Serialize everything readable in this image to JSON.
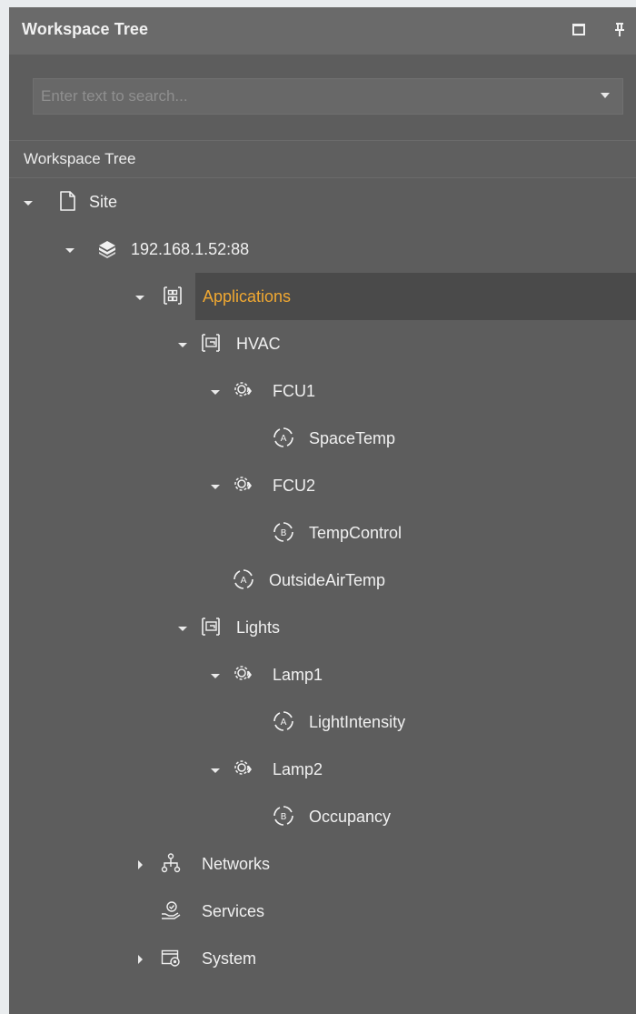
{
  "panel": {
    "title": "Workspace Tree",
    "search": {
      "placeholder": "Enter text to search..."
    },
    "section_label": "Workspace Tree"
  },
  "tree": {
    "site": "Site",
    "server": "192.168.1.52:88",
    "applications": "Applications",
    "hvac": "HVAC",
    "fcu1": "FCU1",
    "spacetemp": "SpaceTemp",
    "fcu2": "FCU2",
    "tempcontrol": "TempControl",
    "outsideairtemp": "OutsideAirTemp",
    "lights": "Lights",
    "lamp1": "Lamp1",
    "lightintensity": "LightIntensity",
    "lamp2": "Lamp2",
    "occupancy": "Occupancy",
    "networks": "Networks",
    "services": "Services",
    "system": "System"
  },
  "selected_item": "Applications",
  "colors": {
    "selected_text": "#f0a832",
    "selected_bg": "#4a4a4a",
    "panel_bg": "#5d5d5d"
  }
}
